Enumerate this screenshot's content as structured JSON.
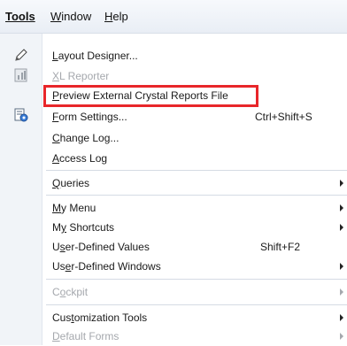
{
  "menubar": {
    "tools": "Tools",
    "window_prefix": "W",
    "window_rest": "indow",
    "help_prefix": "H",
    "help_rest": "elp"
  },
  "menu": {
    "items": [
      {
        "ul": "L",
        "rest": "ayout Designer...",
        "icon": "pencil-icon"
      },
      {
        "ul": "X",
        "rest": "L Reporter",
        "icon": "xl-reporter-icon",
        "disabled": true
      },
      {
        "ul": "P",
        "rest": "review External Crystal Reports File",
        "highlighted": true
      },
      {
        "ul": "F",
        "rest": "orm Settings...",
        "shortcut": "Ctrl+Shift+S",
        "icon": "form-settings-icon"
      },
      {
        "ul": "C",
        "rest": "hange Log..."
      },
      {
        "ul": "A",
        "rest": "ccess Log"
      },
      {
        "ul": "Q",
        "rest": "ueries",
        "submenu": true
      },
      {
        "ul": "M",
        "rest": "y Menu",
        "submenu": true
      },
      {
        "pre": "M",
        "ul": "y",
        "rest": " Shortcuts",
        "submenu": true
      },
      {
        "pre": "U",
        "ul": "s",
        "rest": "er-Defined Values",
        "shortcut": "Shift+F2"
      },
      {
        "pre": "Us",
        "ul": "e",
        "rest": "r-Defined Windows",
        "submenu": true
      },
      {
        "pre": "C",
        "ul": "o",
        "rest": "ckpit",
        "submenu": true,
        "disabled": true
      },
      {
        "pre": "Cus",
        "ul": "t",
        "rest": "omization Tools",
        "submenu": true
      },
      {
        "ul": "D",
        "rest": "efault Forms",
        "submenu": true,
        "disabled": true
      }
    ]
  },
  "colors": {
    "highlight_border": "#e8262a",
    "disabled_text": "#a5a8ad",
    "gutter": "#f1f4f8"
  }
}
